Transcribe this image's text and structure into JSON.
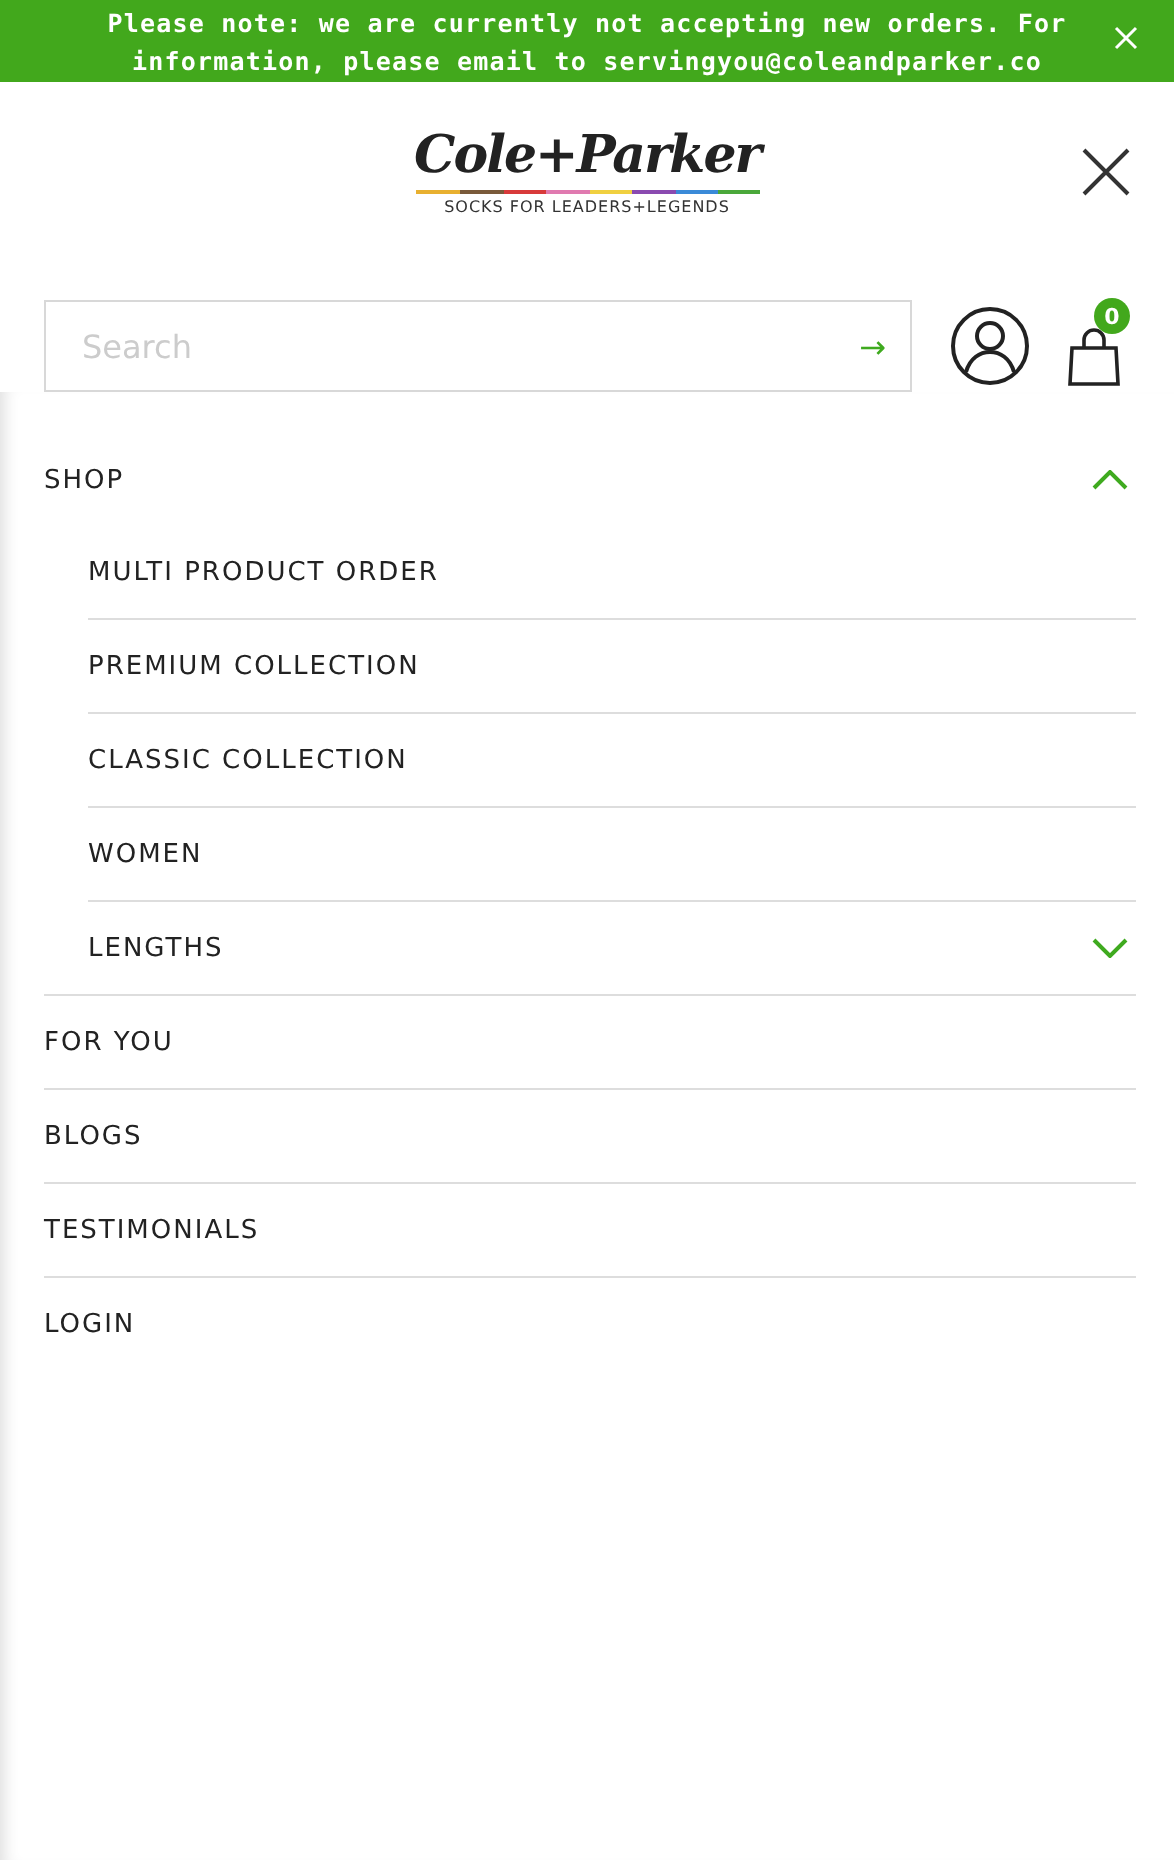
{
  "announcement": {
    "text": "Please note: we are currently not accepting new orders. For information, please email to servingyou@coleandparker.co"
  },
  "logo": {
    "name": "Cole+Parker",
    "tagline": "SOCKS FOR LEADERS+LEGENDS"
  },
  "search": {
    "placeholder": "Search",
    "submit": "→"
  },
  "cart": {
    "count": "0"
  },
  "menu": [
    {
      "label": "SHOP",
      "expanded": true,
      "children": [
        {
          "label": "MULTI PRODUCT ORDER"
        },
        {
          "label": "PREMIUM COLLECTION"
        },
        {
          "label": "CLASSIC COLLECTION"
        },
        {
          "label": "WOMEN"
        },
        {
          "label": "LENGTHS",
          "expanded": false
        }
      ]
    },
    {
      "label": "FOR YOU"
    },
    {
      "label": "BLOGS"
    },
    {
      "label": "TESTIMONIALS"
    },
    {
      "label": "LOGIN"
    }
  ]
}
